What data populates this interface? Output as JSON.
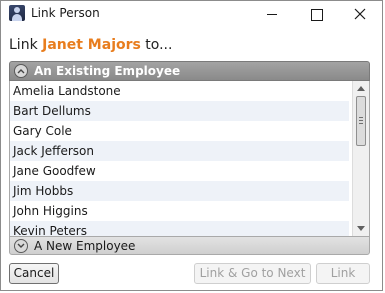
{
  "window": {
    "title": "Link Person",
    "icon": "person-icon"
  },
  "prompt": {
    "prefix": "Link ",
    "name": "Janet Majors",
    "suffix": " to...",
    "name_color": "#e87d1e"
  },
  "existing_section": {
    "label": "An Existing Employee",
    "expanded": true,
    "employees": [
      "Amelia Landstone",
      "Bart Dellums",
      "Gary Cole",
      "Jack Jefferson",
      "Jane Goodfew",
      "Jim  Hobbs",
      "John Higgins",
      "Kevin Peters"
    ]
  },
  "new_section": {
    "label": "A New Employee",
    "expanded": false
  },
  "buttons": {
    "cancel": "Cancel",
    "link_go": "Link & Go to Next",
    "link": "Link"
  }
}
